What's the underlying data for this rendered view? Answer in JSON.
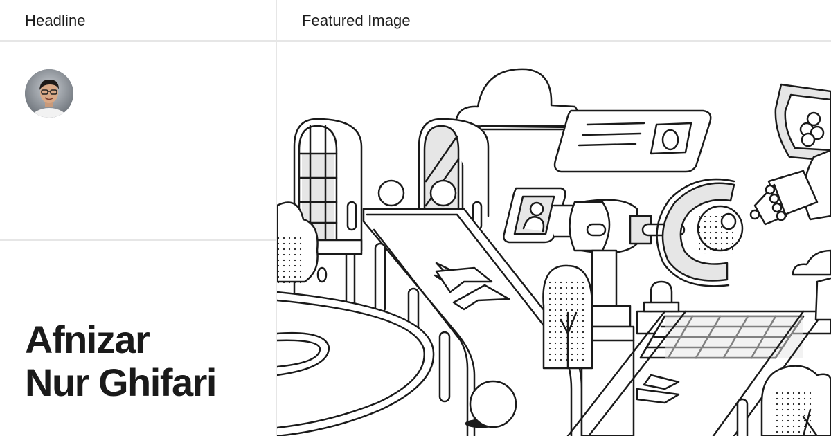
{
  "header": {
    "left_label": "Headline",
    "right_label": "Featured Image"
  },
  "profile": {
    "name_line1": "Afnizar",
    "name_line2": "Nur Ghifari"
  },
  "colors": {
    "text": "#1a1a1a",
    "divider": "#e6e6e6",
    "background": "#ffffff"
  }
}
